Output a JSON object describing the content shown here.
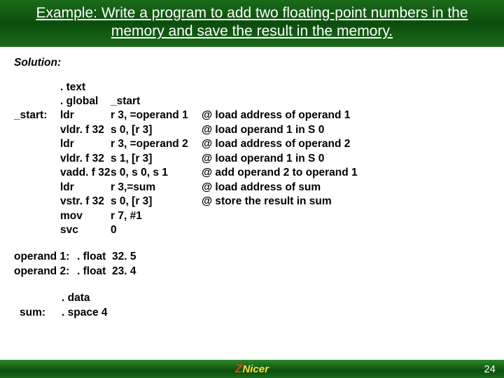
{
  "header": {
    "title": "Example: Write a program to add two floating-point numbers in the memory and save the result in the memory."
  },
  "solution_label": "Solution:",
  "code": {
    "rows": [
      {
        "label": "",
        "mnem": ". text",
        "ops": "",
        "comment": ""
      },
      {
        "label": "",
        "mnem": ". global",
        "ops": "_start",
        "comment": ""
      },
      {
        "label": "_start:",
        "mnem": "ldr",
        "ops": "r 3, =operand 1",
        "comment": "@ load address of operand 1"
      },
      {
        "label": "",
        "mnem": "vldr. f 32",
        "ops": "s 0, [r 3]",
        "comment": "@ load operand 1 in S 0"
      },
      {
        "label": "",
        "mnem": "ldr",
        "ops": "r 3, =operand 2",
        "comment": "@ load address of operand 2"
      },
      {
        "label": "",
        "mnem": "vldr. f 32",
        "ops": "s 1, [r 3]",
        "comment": "@ load operand 1 in S 0"
      },
      {
        "label": "",
        "mnem": "vadd. f 32",
        "ops": "s 0, s 0, s 1",
        "comment": "@ add operand 2 to operand 1"
      },
      {
        "label": "",
        "mnem": "ldr",
        "ops": "r 3,=sum",
        "comment": "@ load address of sum"
      },
      {
        "label": "",
        "mnem": "vstr. f 32",
        "ops": "s 0, [r 3]",
        "comment": "@ store the result in sum"
      },
      {
        "label": "",
        "mnem": "mov",
        "ops": "r 7, #1",
        "comment": ""
      },
      {
        "label": "",
        "mnem": "svc",
        "ops": "0",
        "comment": ""
      }
    ]
  },
  "datasec": {
    "rows": [
      {
        "label": "operand 1:",
        "dir": ". float",
        "val": "32. 5"
      },
      {
        "label": "operand 2:",
        "dir": ". float",
        "val": "23. 4"
      }
    ]
  },
  "sumsec": {
    "rows": [
      {
        "label": "",
        "dir": ". data"
      },
      {
        "label": "sum:",
        "dir": ". space 4"
      }
    ]
  },
  "footer": {
    "logo_z": "Z",
    "logo_rest": "Nicer",
    "page": "24"
  }
}
